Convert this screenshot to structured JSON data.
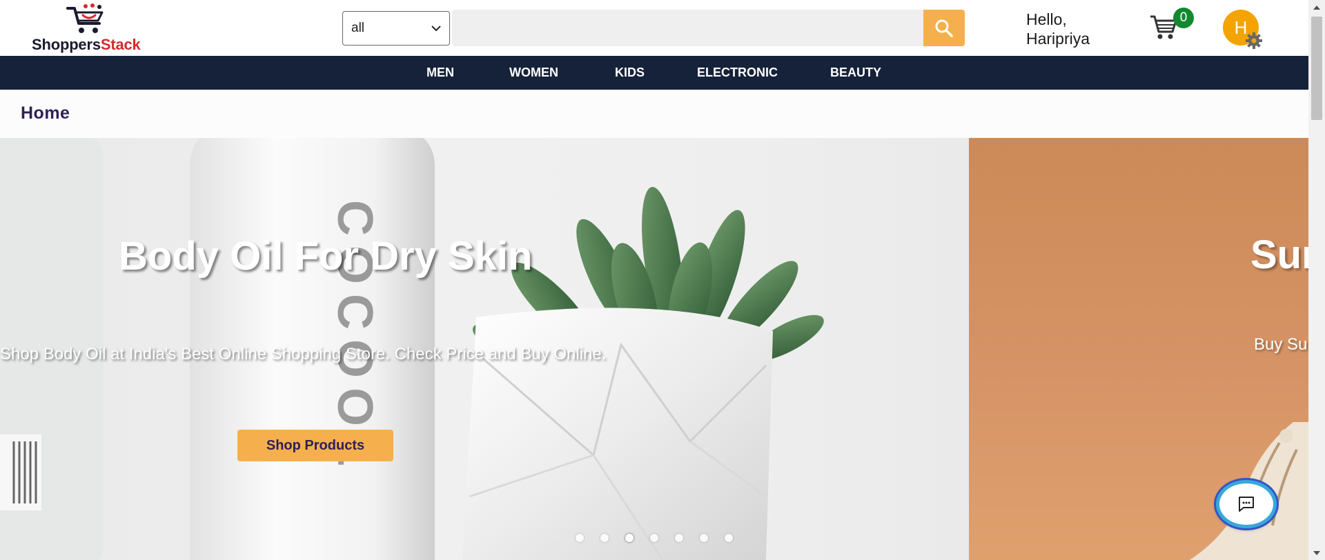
{
  "brand": {
    "name_part1": "Shoppers",
    "name_part2": "Stack",
    "logo_icon": "shopping-cart-logo-icon",
    "accent": "#d6292f"
  },
  "search": {
    "category_selected": "all",
    "placeholder": "",
    "value": "",
    "icon": "search-icon",
    "button_color": "#f5b04d"
  },
  "user": {
    "greeting_line1": "Hello,",
    "greeting_line2": "Haripriya",
    "avatar_initial": "H",
    "avatar_color": "#f5a300",
    "settings_icon": "gear-icon"
  },
  "cart": {
    "icon": "cart-icon",
    "count": "0",
    "badge_color": "#118a2f"
  },
  "nav": {
    "background": "#16213a",
    "items": [
      {
        "label": "MEN"
      },
      {
        "label": "WOMEN"
      },
      {
        "label": "KIDS"
      },
      {
        "label": "ELECTRONIC"
      },
      {
        "label": "BEAUTY"
      }
    ]
  },
  "breadcrumb": {
    "label": "Home"
  },
  "hero": {
    "slides": [
      {
        "title": "Body Oil For Dry Skin",
        "subtitle": "Shop Body Oil at India's Best Online Shopping Store. Check Price and Buy Online.",
        "cta": "Shop Products",
        "image_text": "COCOOL"
      },
      {
        "title": "Sun",
        "subtitle": "Buy Su"
      }
    ],
    "dot_count": 7,
    "active_dot": 3
  },
  "chat": {
    "icon": "chat-icon"
  }
}
